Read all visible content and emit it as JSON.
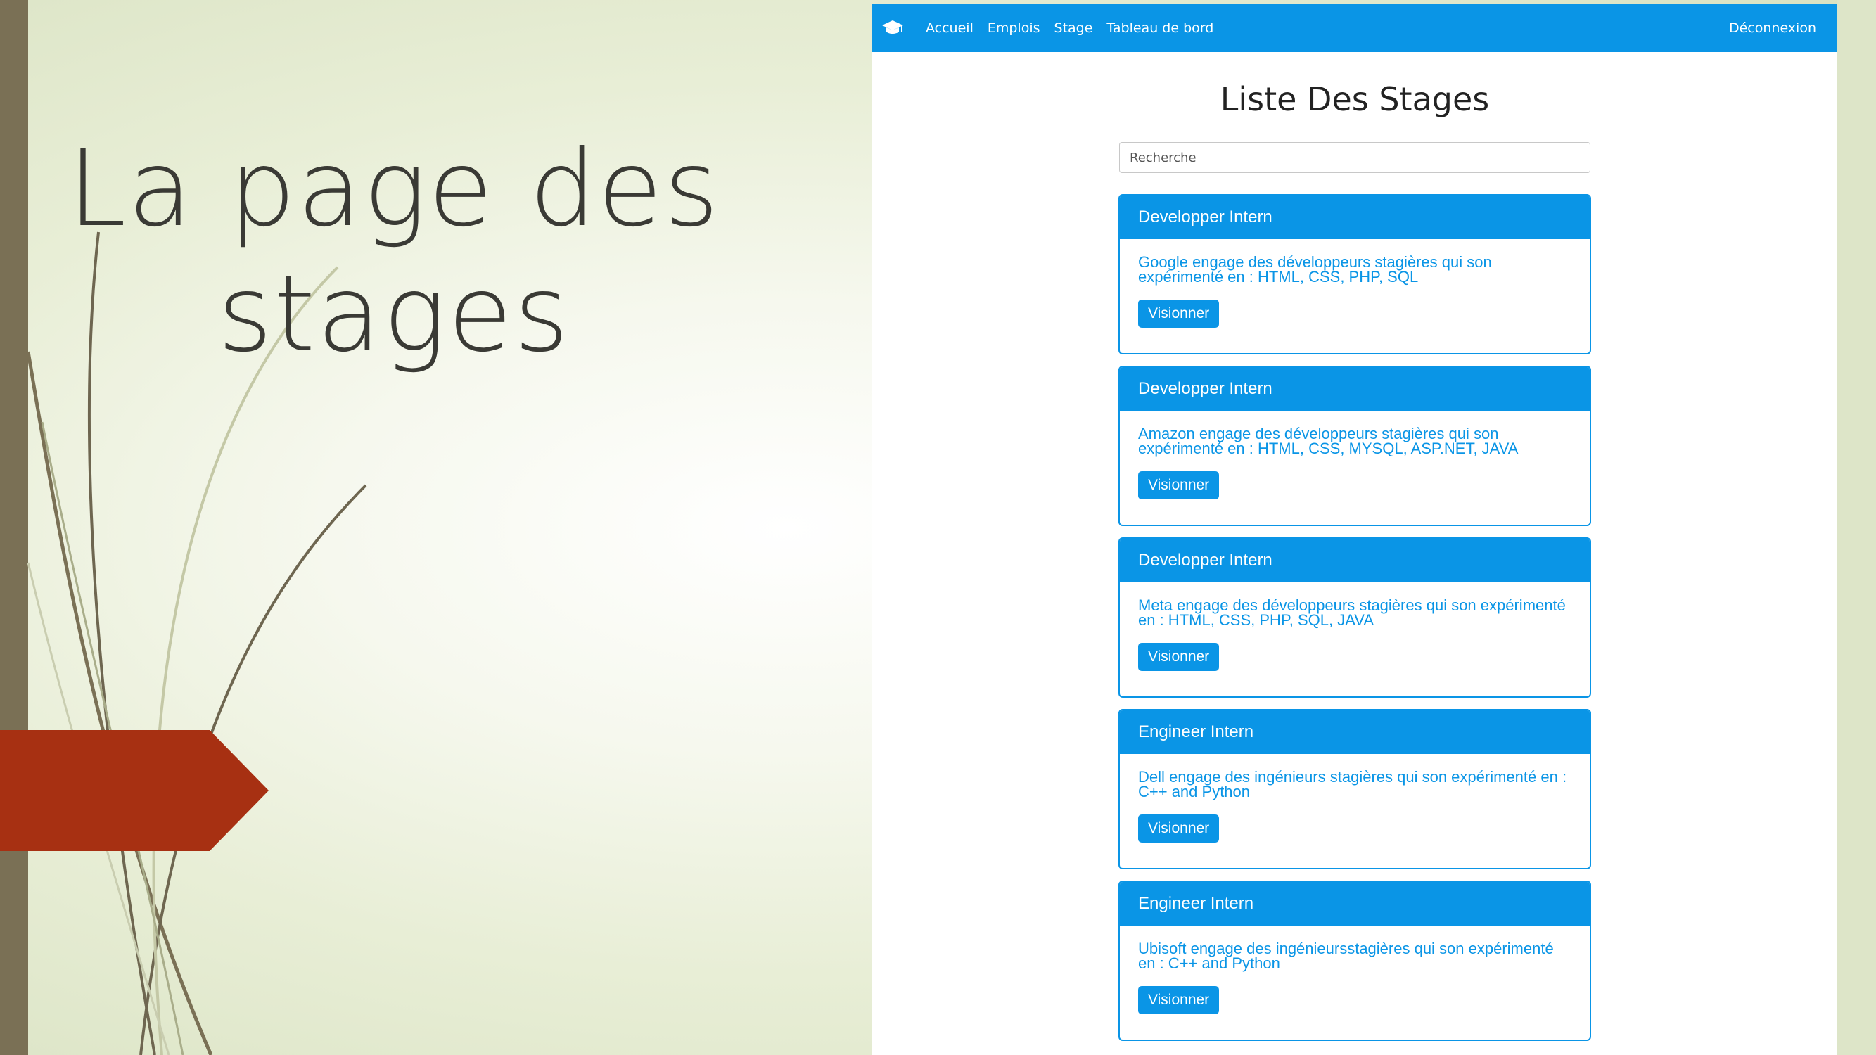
{
  "slide": {
    "title_line1": "La page des",
    "title_line2": "stages"
  },
  "navbar": {
    "brand_icon": "graduation-cap-icon",
    "links": [
      "Accueil",
      "Emplois",
      "Stage",
      "Tableau de bord"
    ],
    "logout": "Déconnexion"
  },
  "page": {
    "heading": "Liste Des Stages",
    "search_placeholder": "Recherche"
  },
  "cards": [
    {
      "title": "Developper Intern",
      "description": "Google engage des développeurs stagières qui son expérimenté en : HTML, CSS, PHP, SQL",
      "button": "Visionner"
    },
    {
      "title": "Developper Intern",
      "description": "Amazon engage des développeurs stagières qui son expérimenté en : HTML, CSS, MYSQL, ASP.NET, JAVA",
      "button": "Visionner"
    },
    {
      "title": "Developper Intern",
      "description": "Meta engage des développeurs stagières qui son expérimenté en : HTML, CSS, PHP, SQL, JAVA",
      "button": "Visionner"
    },
    {
      "title": "Engineer Intern",
      "description": "Dell engage des ingénieurs stagières qui son expérimenté en : C++ and Python",
      "button": "Visionner"
    },
    {
      "title": "Engineer Intern",
      "description": "Ubisoft engage des ingénieursstagières qui son expérimenté en : C++ and Python",
      "button": "Visionner"
    }
  ],
  "colors": {
    "accent": "#0a95e6",
    "arrow": "#a73012",
    "sidebar": "#7a7055"
  }
}
